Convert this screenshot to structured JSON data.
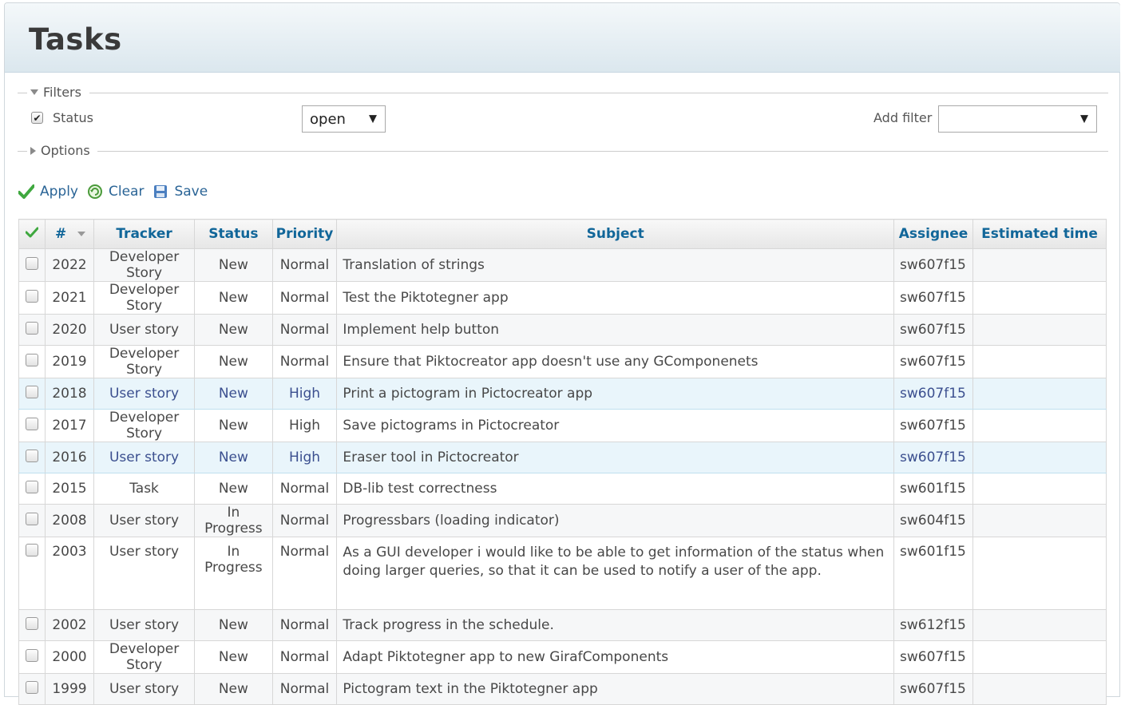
{
  "page": {
    "title": "Tasks"
  },
  "filters": {
    "legend": "Filters",
    "status_label": "Status",
    "status_value": "open",
    "add_filter_label": "Add filter",
    "add_filter_value": ""
  },
  "options": {
    "legend": "Options"
  },
  "actions": {
    "apply": "Apply",
    "clear": "Clear",
    "save": "Save"
  },
  "columns": [
    "#",
    "Tracker",
    "Status",
    "Priority",
    "Subject",
    "Assignee",
    "Estimated time"
  ],
  "rows": [
    {
      "id": "2022",
      "tracker": "Developer Story",
      "status": "New",
      "priority": "Normal",
      "subject": "Translation of strings",
      "assignee": "sw607f15",
      "est": ""
    },
    {
      "id": "2021",
      "tracker": "Developer Story",
      "status": "New",
      "priority": "Normal",
      "subject": "Test the Piktotegner app",
      "assignee": "sw607f15",
      "est": ""
    },
    {
      "id": "2020",
      "tracker": "User story",
      "status": "New",
      "priority": "Normal",
      "subject": "Implement help button",
      "assignee": "sw607f15",
      "est": ""
    },
    {
      "id": "2019",
      "tracker": "Developer Story",
      "status": "New",
      "priority": "Normal",
      "subject": "Ensure that Piktocreator app doesn't use any GComponenets",
      "assignee": "sw607f15",
      "est": ""
    },
    {
      "id": "2018",
      "tracker": "User story",
      "status": "New",
      "priority": "High",
      "subject": "Print a pictogram in Pictocreator app",
      "assignee": "sw607f15",
      "est": ""
    },
    {
      "id": "2017",
      "tracker": "Developer Story",
      "status": "New",
      "priority": "High",
      "subject": "Save pictograms in Pictocreator",
      "assignee": "sw607f15",
      "est": ""
    },
    {
      "id": "2016",
      "tracker": "User story",
      "status": "New",
      "priority": "High",
      "subject": "Eraser tool in Pictocreator",
      "assignee": "sw607f15",
      "est": ""
    },
    {
      "id": "2015",
      "tracker": "Task",
      "status": "New",
      "priority": "Normal",
      "subject": "DB-lib test correctness",
      "assignee": "sw601f15",
      "est": ""
    },
    {
      "id": "2008",
      "tracker": "User story",
      "status": "In Progress",
      "priority": "Normal",
      "subject": "Progressbars (loading indicator)",
      "assignee": "sw604f15",
      "est": ""
    },
    {
      "id": "2003",
      "tracker": "User story",
      "status": "In Progress",
      "priority": "Normal",
      "subject": "As a GUI developer i would like to be able to get information of the status when doing larger queries, so that it can be used to notify a user of the app.",
      "assignee": "sw601f15",
      "est": ""
    },
    {
      "id": "2002",
      "tracker": "User story",
      "status": "New",
      "priority": "Normal",
      "subject": "Track progress in the schedule.",
      "assignee": "sw612f15",
      "est": ""
    },
    {
      "id": "2000",
      "tracker": "Developer Story",
      "status": "New",
      "priority": "Normal",
      "subject": "Adapt Piktotegner app to new GirafComponents",
      "assignee": "sw607f15",
      "est": ""
    },
    {
      "id": "1999",
      "tracker": "User story",
      "status": "New",
      "priority": "Normal",
      "subject": "Pictogram text in the Piktotegner app",
      "assignee": "sw607f15",
      "est": ""
    }
  ],
  "colors": {
    "link": "#2a6496",
    "header_text": "#116699",
    "highlight_row": "#e9f5fb",
    "check_green": "#4caf50"
  }
}
